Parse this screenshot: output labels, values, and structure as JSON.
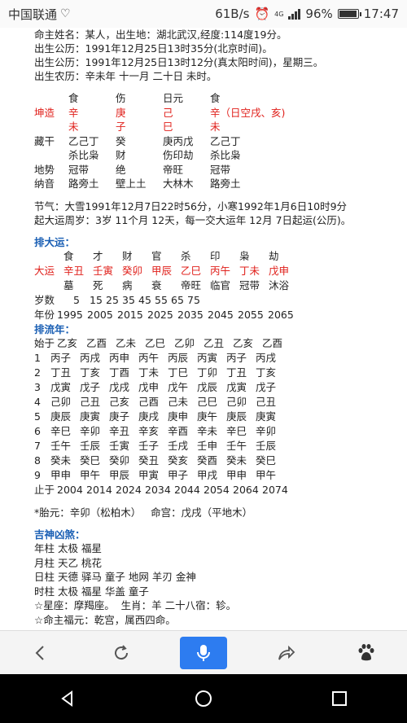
{
  "status": {
    "carrier": "中国联通",
    "speed": "61B/s",
    "net": "4G",
    "battery": "96%",
    "time": "17:47"
  },
  "info": [
    "命主姓名：某人，出生地：湖北武汉,经度:114度19分。",
    "出生公历：1991年12月25日13时35分(北京时间)。",
    "出生公历：1991年12月25日13时12分(真太阳时间)，星期三。",
    "出生农历：辛未年 十一月 二十日 未时。"
  ],
  "pillars": {
    "header": [
      "",
      "食",
      "伤",
      "日元",
      "食"
    ],
    "label": "坤造",
    "stems": [
      "辛",
      "庚",
      "己",
      "辛（日空戌、亥)"
    ],
    "branches": [
      "未",
      "子",
      "巳",
      "未"
    ],
    "rows": [
      [
        "藏干",
        "乙己丁",
        "癸",
        "庚丙戊",
        "乙己丁"
      ],
      [
        "",
        "杀比枭",
        "财",
        "伤印劫",
        "杀比枭"
      ],
      [
        "地势",
        "冠带",
        "绝",
        "帝旺",
        "冠带"
      ],
      [
        "纳音",
        "路旁土",
        "壁上土",
        "大林木",
        "路旁土"
      ]
    ]
  },
  "jieqi": [
    "节气：大雪1991年12月7日22时56分，小寒1992年1月6日10时9分",
    "起大运周岁：3岁 11个月 12天，每一交大运年 12月 7日起运(公历)。"
  ],
  "dayun": {
    "title": "排大运：",
    "gods": [
      "食",
      "才",
      "财",
      "官",
      "杀",
      "印",
      "枭",
      "劫"
    ],
    "label": "大运",
    "yun": [
      "辛丑",
      "壬寅",
      "癸卯",
      "甲辰",
      "乙巳",
      "丙午",
      "丁未",
      "戊申"
    ],
    "states": [
      "墓",
      "死",
      "病",
      "衰",
      "帝旺",
      "临官",
      "冠带",
      "沐浴"
    ],
    "age_label": "岁数",
    "ages": [
      "5",
      "15",
      "25",
      "35",
      "45",
      "55",
      "65",
      "75"
    ],
    "year_label": "年份",
    "years": [
      "1995",
      "2005",
      "2015",
      "2025",
      "2035",
      "2045",
      "2055",
      "2065"
    ]
  },
  "liunian": {
    "title": "排流年：",
    "start_label": "始于",
    "start": [
      "乙亥",
      "乙酉",
      "乙未",
      "乙巳",
      "乙卯",
      "乙丑",
      "乙亥",
      "乙酉"
    ],
    "rows": [
      {
        "n": "1",
        "v": [
          "丙子",
          "丙戌",
          "丙申",
          "丙午",
          "丙辰",
          "丙寅",
          "丙子",
          "丙戌"
        ]
      },
      {
        "n": "2",
        "v": [
          "丁丑",
          "丁亥",
          "丁酉",
          "丁未",
          "丁巳",
          "丁卯",
          "丁丑",
          "丁亥"
        ]
      },
      {
        "n": "3",
        "v": [
          "戊寅",
          "戊子",
          "戊戌",
          "戊申",
          "戊午",
          "戊辰",
          "戊寅",
          "戊子"
        ]
      },
      {
        "n": "4",
        "v": [
          "己卯",
          "己丑",
          "己亥",
          "己酉",
          "己未",
          "己巳",
          "己卯",
          "己丑"
        ]
      },
      {
        "n": "5",
        "v": [
          "庚辰",
          "庚寅",
          "庚子",
          "庚戌",
          "庚申",
          "庚午",
          "庚辰",
          "庚寅"
        ]
      },
      {
        "n": "6",
        "v": [
          "辛巳",
          "辛卯",
          "辛丑",
          "辛亥",
          "辛酉",
          "辛未",
          "辛巳",
          "辛卯"
        ]
      },
      {
        "n": "7",
        "v": [
          "壬午",
          "壬辰",
          "壬寅",
          "壬子",
          "壬戌",
          "壬申",
          "壬午",
          "壬辰"
        ]
      },
      {
        "n": "8",
        "v": [
          "癸未",
          "癸巳",
          "癸卯",
          "癸丑",
          "癸亥",
          "癸酉",
          "癸未",
          "癸巳"
        ]
      },
      {
        "n": "9",
        "v": [
          "甲申",
          "甲午",
          "甲辰",
          "甲寅",
          "甲子",
          "甲戌",
          "甲申",
          "甲午"
        ]
      }
    ],
    "end_label": "止于",
    "end": [
      "2004",
      "2014",
      "2024",
      "2034",
      "2044",
      "2054",
      "2064",
      "2074"
    ]
  },
  "taiyuan": "*胎元：辛卯（松柏木）   命宫：戊戌（平地木）",
  "shensha": {
    "title": "吉神凶煞：",
    "lines": [
      "年柱 太极 福星",
      "月柱 天乙 桃花",
      "日柱 天德 驿马 童子 地网 羊刃 金神",
      "时柱 太极 福星 华盖 童子",
      "☆星座：摩羯座。  生肖：羊 二十八宿：轸。",
      "☆命主福元：乾宫，属西四命。"
    ]
  }
}
